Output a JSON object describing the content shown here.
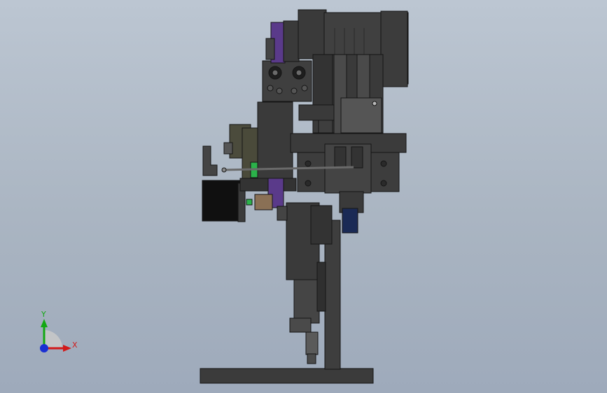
{
  "viewport": {
    "background_top": "#bcc6d2",
    "background_bottom": "#9eaabb"
  },
  "model": {
    "body_color": "#3a3a3a",
    "edge_color": "#151515",
    "accent_green": "#2bb24a",
    "accent_purple": "#5a3a8a",
    "accent_navy": "#1a2a55"
  },
  "triad": {
    "x_label": "X",
    "y_label": "Y",
    "x_color": "#d21a1a",
    "y_color": "#13a813",
    "z_color": "#1a2fd2",
    "icon": "coordinate-triad-icon"
  }
}
